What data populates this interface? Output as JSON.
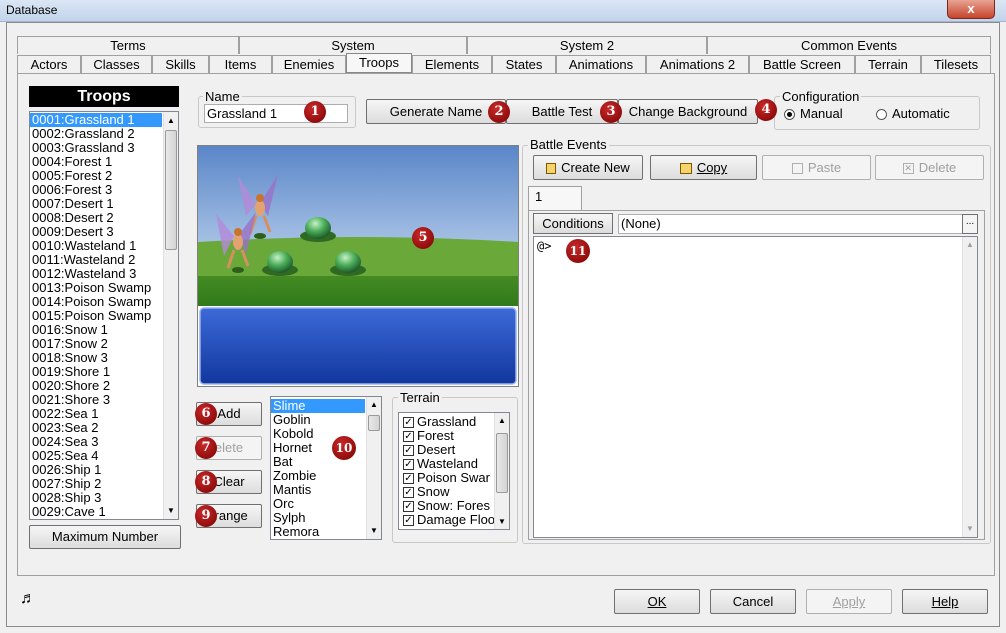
{
  "window": {
    "title": "Database",
    "close": "x"
  },
  "tabs_row1": [
    "Terms",
    "System",
    "System 2",
    "Common Events"
  ],
  "tabs_row2": [
    "Actors",
    "Classes",
    "Skills",
    "Items",
    "Enemies",
    "Troops",
    "Elements",
    "States",
    "Animations",
    "Animations 2",
    "Battle Screen",
    "Terrain",
    "Tilesets"
  ],
  "troops": {
    "header": "Troops",
    "items": [
      "0001:Grassland 1",
      "0002:Grassland 2",
      "0003:Grassland 3",
      "0004:Forest 1",
      "0005:Forest 2",
      "0006:Forest 3",
      "0007:Desert 1",
      "0008:Desert 2",
      "0009:Desert 3",
      "0010:Wasteland 1",
      "0011:Wasteland 2",
      "0012:Wasteland 3",
      "0013:Poison Swamp",
      "0014:Poison Swamp",
      "0015:Poison Swamp",
      "0016:Snow 1",
      "0017:Snow 2",
      "0018:Snow 3",
      "0019:Shore 1",
      "0020:Shore 2",
      "0021:Shore 3",
      "0022:Sea 1",
      "0023:Sea 2",
      "0024:Sea 3",
      "0025:Sea 4",
      "0026:Ship 1",
      "0027:Ship 2",
      "0028:Ship 3",
      "0029:Cave 1"
    ],
    "max_button": "Maximum Number"
  },
  "name": {
    "label": "Name",
    "value": "Grassland 1"
  },
  "buttons": {
    "generate": "Generate Name",
    "battle_test": "Battle Test",
    "change_bg": "Change Background"
  },
  "configuration": {
    "label": "Configuration",
    "manual": "Manual",
    "automatic": "Automatic",
    "selected": "manual"
  },
  "troop_buttons": {
    "add": "Add",
    "delete": "elete",
    "clear": "Clear",
    "arrange": "rrange"
  },
  "enemies": [
    "Slime",
    "Goblin",
    "Kobold",
    "Hornet",
    "Bat",
    "Zombie",
    "Mantis",
    "Orc",
    "Sylph",
    "Remora"
  ],
  "terrain": {
    "label": "Terrain",
    "items": [
      "Grassland",
      "Forest",
      "Desert",
      "Wasteland",
      "Poison Swar",
      "Snow",
      "Snow: Fores",
      "Damage Floo"
    ]
  },
  "battle_events": {
    "label": "Battle Events",
    "create": "Create New",
    "copy": "Copy",
    "paste": "Paste",
    "delete": "Delete",
    "page_tab": "1",
    "conditions_btn": "Conditions",
    "conditions_value": "(None)",
    "ellipsis": "...",
    "line1": "@>"
  },
  "badges": [
    "1",
    "2",
    "3",
    "4",
    "5",
    "6",
    "7",
    "8",
    "9",
    "10",
    "11"
  ],
  "footer": {
    "ok": "OK",
    "cancel": "Cancel",
    "apply": "Apply",
    "help": "Help"
  },
  "colors": {
    "selection": "#3399ff",
    "badge": "#9b1010",
    "msgwin": "#1e4ec0"
  }
}
